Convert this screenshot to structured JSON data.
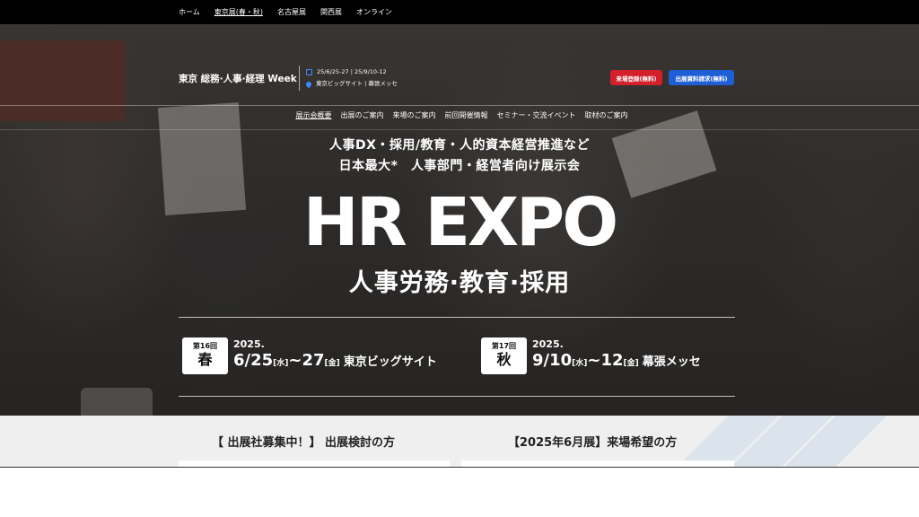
{
  "topnav": {
    "links": [
      "ホーム",
      "東京展(春・秋)",
      "名古屋展",
      "関西展",
      "オンライン"
    ]
  },
  "header": {
    "site_title": "東京 総務·人事·経理 Week",
    "dates": "25/6/25-27 | 25/9/10-12",
    "venues": "東京ビッグサイト | 幕張メッセ",
    "visitor_button": "来場登録(無料)",
    "exhibitor_button": "出展資料請求(無料)"
  },
  "mainnav": {
    "items": [
      "展示会概要",
      "出展のご案内",
      "来場のご案内",
      "前回開催情報",
      "セミナー・交流イベント",
      "取材のご案内"
    ]
  },
  "hero": {
    "tagline1": "人事DX・採用/教育・人的資本経営推進など",
    "tagline2": "日本最大*　人事部門・経営者向け展示会",
    "logo_text": "HR EXPO",
    "subtitle": "人事労務·教育·採用"
  },
  "events": {
    "spring": {
      "number": "第16回",
      "season": "春",
      "year": "2025.",
      "start": "6/25",
      "start_dow": "[水]",
      "tilde": "~",
      "end": "27",
      "end_dow": "[金]",
      "venue": "東京ビッグサイト"
    },
    "autumn": {
      "number": "第17回",
      "season": "秋",
      "year": "2025.",
      "start": "9/10",
      "start_dow": "[水]",
      "tilde": "~",
      "end": "12",
      "end_dow": "[金]",
      "venue": "幕張メッセ"
    }
  },
  "below": {
    "exhibitor_heading": "【 出展社募集中！】 出展検討の方",
    "visitor_heading": "【2025年6月展】来場希望の方"
  },
  "icons": {
    "calendar": "calendar-icon",
    "location": "location-pin-icon",
    "scroll": "chevron-down-icon"
  },
  "colors": {
    "visitor_button": "#d3202a",
    "exhibitor_button": "#1f5fd6",
    "accent_icon": "#3d8bff",
    "topbar": "#000000"
  }
}
